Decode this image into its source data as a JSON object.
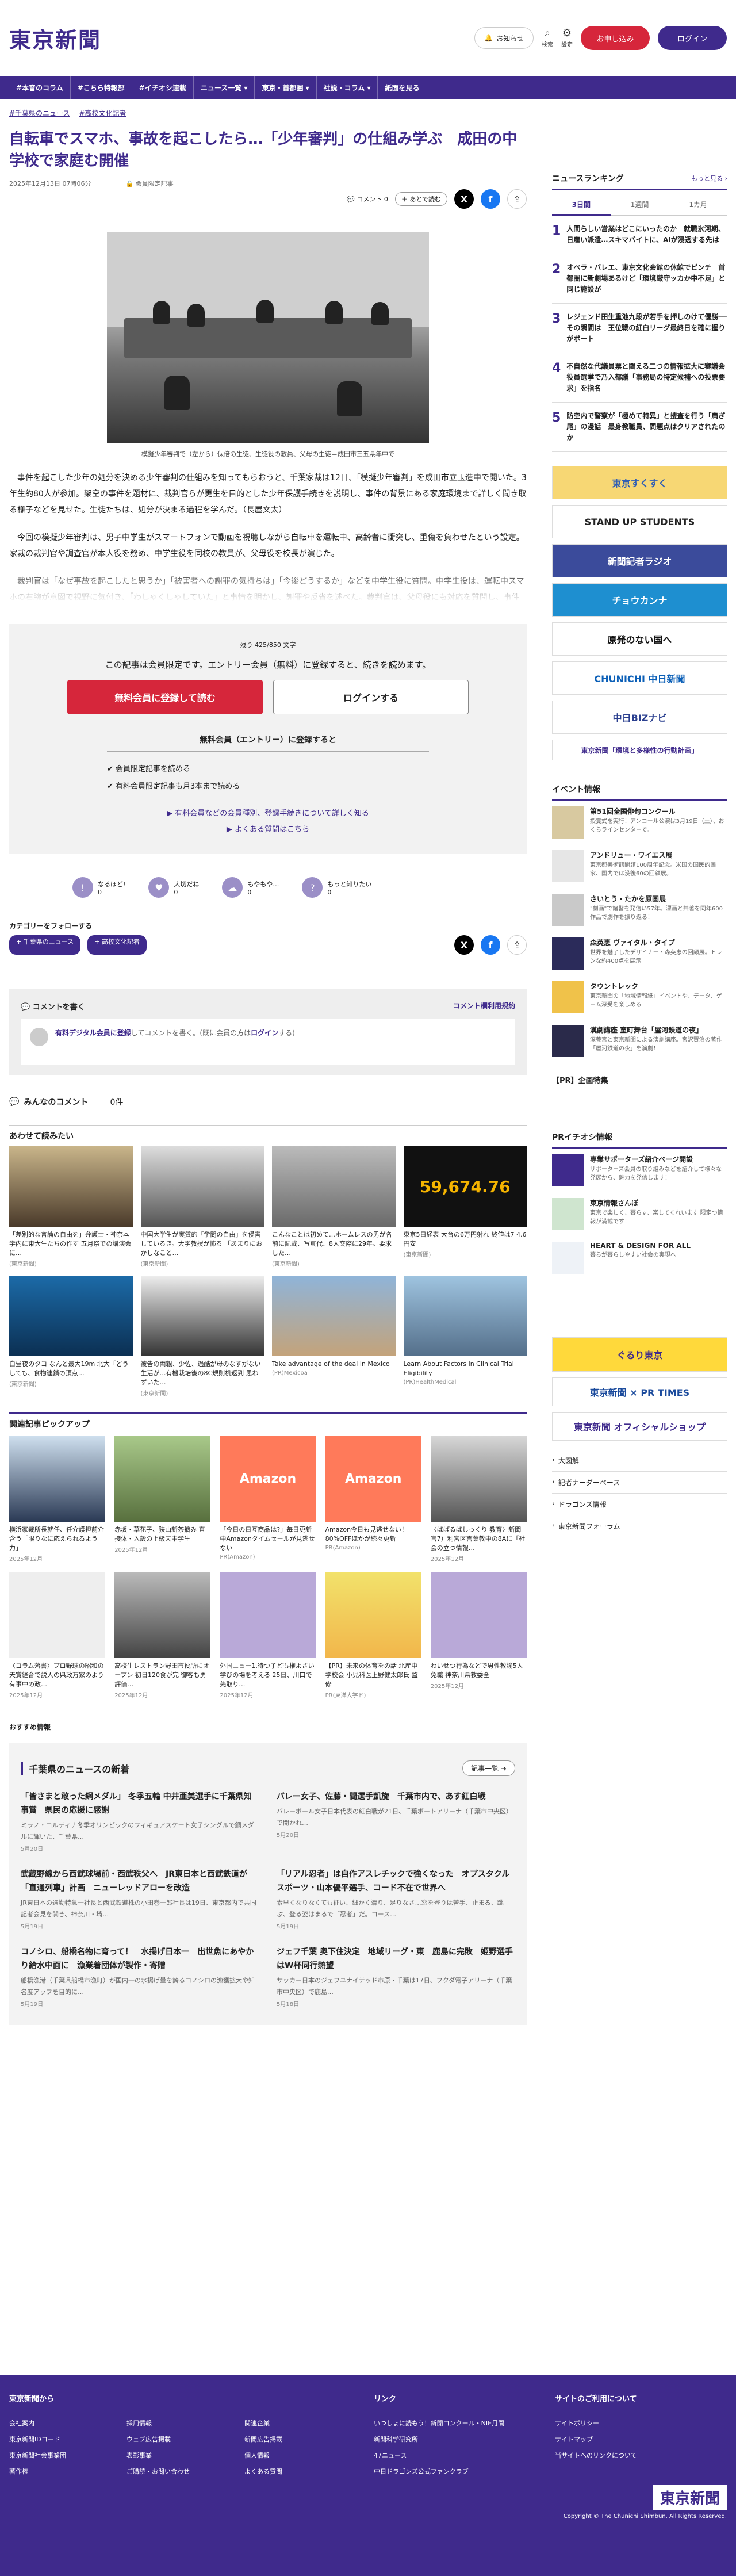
{
  "header": {
    "logo": "東京新聞",
    "notice_label": "お知らせ",
    "search_label": "検索",
    "settings_label": "設定",
    "apply_label": "お申し込み",
    "login_label": "ログイン"
  },
  "nav": [
    "#本音のコラム",
    "#こちら特報部",
    "#イチオシ連載",
    "ニュース一覧 ▾",
    "東京・首都圏 ▾",
    "社説・コラム ▾",
    "紙面を見る"
  ],
  "breadcrumbs": [
    "#千葉県のニュース",
    "#高校文化記者"
  ],
  "article": {
    "title": "自転車でスマホ、事故を起こしたら…「少年審判」の仕組み学ぶ　成田の中学校で means 開催",
    "title_fixed": "自転車でスマホ、事故を起こしたら…「少年審判」の仕組み学ぶ　成田の中学校で家庭む開催",
    "date": "2025年12月13日 07時06分",
    "member_label": "会員限定記事",
    "comment_label": "コメント",
    "comment_count": "0",
    "later_label": "あとで読む",
    "caption": "模擬少年審判で（左から）保倍の生徒、生徒役の教員、父母の生徒＝成田市三五県年中で",
    "paragraphs": [
      "事件を起こした少年の処分を決める少年審判の仕組みを知ってもらおうと、千葉家裁は12日、「模擬少年審判」を成田市立玉造中で開いた。3年生約80人が参加。架空の事件を題材に、裁判官らが更生を目的とした少年保護手続きを説明し、事件の背景にある家庭環境まで詳しく聞き取る様子などを見せた。生徒たちは、処分が決まる過程を学んだ。（長屋文太）",
      "今回の模擬少年審判は、男子中学生がスマートフォンで動画を視聴しながら自転車を運転中、高齢者に衝突し、重傷を負わせたという設定。家裁の裁判官や調査官が本人役を務め、中学生役を同校の教員が、父母役を校長が演じた。",
      "裁判官は「なぜ事故を起こしたと思うか」「被害者への謝罪の気持ちは」「今後どうするか」などを中学生役に質問。中学生役は、運転中スマホの右腕が意図で視野に気付き、「わしゃくしゃしていた」と事情を明かし、謝罪や反省を述べた。裁判官は、父母役にも対応を質問し、事件の背景を詳しく聞いた。父母役は「将来を反省を話し…"
    ]
  },
  "paywall": {
    "count": "残り 425/850 文字",
    "lead": "この記事は会員限定です。エントリー会員（無料）に登録すると、続きを読めます。",
    "register_label": "無料会員に登録して読む",
    "login_label": "ログインする",
    "benefit_title": "無料会員（エントリー）に登録すると",
    "benefits": [
      "会員限定記事を読める",
      "有料会員限定記事も月3本まで読める"
    ],
    "link1": "有料会員などの会員種別、登録手続きについて詳しく知る",
    "link2": "よくある質問はこちら"
  },
  "reactions": [
    {
      "label": "なるほど!",
      "count": "0"
    },
    {
      "label": "大切だね",
      "count": "0"
    },
    {
      "label": "もやもや…",
      "count": "0"
    },
    {
      "label": "もっと知りたい",
      "count": "0"
    }
  ],
  "follow": {
    "title": "カテゴリーをフォローする",
    "tags": [
      "+ 千葉県のニュース",
      "+ 高校文化記者"
    ]
  },
  "comment_box": {
    "title": "コメントを書く",
    "policy": "コメント欄利用規約",
    "prompt_link": "有料デジタル会員に登録",
    "prompt_mid": "してコメントを書く。(既に会員の方は",
    "prompt_login": "ログイン",
    "prompt_end": "する)"
  },
  "everyone_comments": {
    "title": "みんなのコメント",
    "count": "0件"
  },
  "also_read": {
    "title": "あわせて読みたい",
    "items": [
      {
        "text": "「差別的な言論の自由を」弁護士・神奈本学内に東大生たちの作す 五月祭での講演会に…",
        "src": "(東京新聞)"
      },
      {
        "text": "中国大学生が実質的「学問の自由」を侵害しているき。大学教授が怖る 「あまりにおかしなこと…",
        "src": "(東京新聞)"
      },
      {
        "text": "こんなことは初めて…ホームレスの男が名前に記載、写真代、8人交際に29年。要求した…",
        "src": "(東京新聞)"
      },
      {
        "text": "東京5日経表 大台の6万円射れ 終値は7 4.6円安",
        "src": "(東京新聞)"
      },
      {
        "text": "白昼夜のタコ なんと最大19m 北大「どうしても、食物連鎖の頂点…",
        "src": "(東京新聞)"
      },
      {
        "text": "被告の両親、少佐、過酷が母のなすがない生活が…有機栽培後の8C規則机返到 思わずいた…",
        "src": "(東京新聞)"
      },
      {
        "text": "Take advantage of the deal in Mexico",
        "src": "(PR)Mexicoa"
      },
      {
        "text": "Learn About Factors in Clinical Trial Eligibility",
        "src": "(PR)HealthMedical"
      }
    ]
  },
  "pickup": {
    "title": "関連記事ピックアップ",
    "items": [
      {
        "text": "横浜家裁所長就任、任介護担前介含う「限りなに応えられるよう力」",
        "date": "2025年12月"
      },
      {
        "text": "赤坂・草花子、狭山新茶摘み 直接体・入殻の上級天中学生",
        "date": "2025年12月"
      },
      {
        "text": "「今日の日互商品は?」毎日更新中Amazonタイムセールが見逃せない",
        "date": "PR(Amazon)"
      },
      {
        "text": "Amazon今日も見逃せない！80%OFFほかが続々更新",
        "date": "PR(Amazon)"
      },
      {
        "text": "〈ぱぱるぱしっくり 教育〉新聞官7）利宮区言葉教中の8Aに「社会の立つ情報…",
        "date": "2025年12月"
      },
      {
        "text": "〈コラム落書〉プロ野球の昭和の天賞経合で説人の県政万家のより有事中の政…",
        "date": "2025年12月"
      },
      {
        "text": "高校生レストラン野田市役所にオープン 初日120食が完 御客も勇評価…",
        "date": "2025年12月"
      },
      {
        "text": "外国ニュー1.待つ子ども権よさい学びの場を考える 25日、川口で先取り…",
        "date": "2025年12月"
      },
      {
        "text": "【PR】未来の体育をの話 北産中学校会 小児科医上野健太郎氏 監修",
        "date": "PR(東洋大学ド)"
      },
      {
        "text": "わいせつ行為などで男性教諭5人免職 神奈川県教委全",
        "date": "2025年12月"
      }
    ]
  },
  "recommend": "おすすめ情報",
  "chiba_news": {
    "title": "千葉県のニュースの新着",
    "more": "記事一覧 ➜",
    "items": [
      {
        "title": "「皆さまと敢った網メダル」 冬季五輪 中井亜美選手に千葉県知事賞　県民の応援に感謝",
        "snippet": "ミラノ・コルティナ冬季オリンピックのフィギュアスケート女子シングルで銅メダルに輝いた、千葉県…",
        "date": "5月20日"
      },
      {
        "title": "バレー女子、佐藤・間選手凱旋　千葉市内で、あす紅白戦",
        "snippet": "バレーボール女子日本代表の紅白戦が21日、千葉ポートアリーナ（千葉市中央区）で開かれ…",
        "date": "5月20日"
      },
      {
        "title": "武蔵野線から西武球場前・西武秩父へ　JR東日本と西武鉄道が「直通列車」計画　ニューレッドアローを改造",
        "snippet": "JR東日本の通勤特急一社長と西武鉄道株の小田巻一郎社長は19日、東京都内で共同記者会見を開き、神奈川・埼…",
        "date": "5月19日"
      },
      {
        "title": "「リアル忍者」は自作アスレチックで強くなった　オプスタクルスポーツ・山本優平選手、コード不在で世界へ",
        "snippet": "素早くなりなくても征い、細かく滑り、足りなさ…窓を登りは苦手、止まる、跳ぶ、登る姿はまるで「忍者」だ。コース…",
        "date": "5月19日"
      },
      {
        "title": "コノシロ、船橋名物に育って！　水揚げ日本一　出世魚にあやかり給水中面に　漁業着団体が製作・寄贈",
        "snippet": "船橋漁港（千葉県船橋市漁町）が国内一の水揚げ量を誇るコノシロの漁獲拡大や知名度アップを目的に…",
        "date": "5月19日"
      },
      {
        "title": "ジェフ千葉 奥下住決定　地域リーグ・東　鹿島に完敗　姫野選手はW杯同行熱望",
        "snippet": "サッカー日本のジェフユナイテッド市原・千葉は17日、フクダ電子アリーナ（千葉市中央区）で鹿島…",
        "date": "5月18日"
      }
    ]
  },
  "ranking": {
    "title": "ニュースランキング",
    "more": "もっと見る ›",
    "tabs": [
      "3日間",
      "1週間",
      "1カ月"
    ],
    "items": [
      "人間らしい営業はどこにいったのか　就職氷河期、日雇い派遣…スキマバイトに、AIが浸透する先は",
      "オペラ・バレエ、東京文化会館の休館でピンチ　首都圏に新劇場あるけど「環境厳守ッカか中不足」と同じ施設が",
      "レジェンド田生重池九段が若手を押しのけて優勝──その瞬間は　王位戦の紅白リーグ最終日を確に握りがポート",
      "不自然な代議員票と関える二つの情報拡大に審議会役員選挙で乃入都議「事務局の特定候補への投票要求」を指名",
      "防空内で警察が「極めて特異」と捜査を行う「肩ぎ尾」の漫話　最身教職員、問題点はクリアされたのか"
    ]
  },
  "banners": [
    {
      "label": "東京すくすく",
      "bg": "#f7d774",
      "fg": "#2e5db5"
    },
    {
      "label": "STAND UP STUDENTS",
      "bg": "#ffffff",
      "fg": "#222222"
    },
    {
      "label": "新聞記者ラジオ",
      "bg": "#3b4b9b",
      "fg": "#ffffff"
    },
    {
      "label": "チョウカンナ",
      "bg": "#1e8fd0",
      "fg": "#ffffff"
    },
    {
      "label": "原発のない国へ",
      "bg": "#ffffff",
      "fg": "#111111"
    },
    {
      "label": "CHUNICHI 中日新聞",
      "bg": "#ffffff",
      "fg": "#0b5fb7"
    },
    {
      "label": "中日BIZナビ",
      "bg": "#ffffff",
      "fg": "#2a3f8f"
    },
    {
      "label": "東京新聞「環境と多様性の行動計画」",
      "bg": "#ffffff",
      "fg": "#3f2a8c"
    }
  ],
  "events": {
    "title": "イベント情報",
    "items": [
      {
        "title": "第51回全国俳句コンクール",
        "desc": "授賞式を実行！アンコール公演は3月19日（土）、おくらラインセンターで。"
      },
      {
        "title": "アンドリュー・ワイエス展",
        "desc": "東京都美術館開館100周年記念。米国の国民的画家、国内では没後60の回顧展。"
      },
      {
        "title": "さいとう・たかを原画展",
        "desc": "\"劇画\"で諸習を発信い57年。漂画と共著を同年600作品で劇作を振り返る！"
      },
      {
        "title": "森英恵 ヴァイタル・タイプ",
        "desc": "世界を魅了したデザイナー・森英恵の回顧展。トレンな約400点を展示"
      },
      {
        "title": "タウントレック",
        "desc": "東京新聞の「地域情報紙」イベントや、データ、ゲーム深受を楽しめる"
      },
      {
        "title": "漢劇講座 室町舞台「屋河鉄道の夜」",
        "desc": "深養宮と東京新聞による演劇講座。宮沢賢治の著作「屋河鉄道の夜」を演劇！"
      }
    ]
  },
  "pr_label": "【PR】企画特集",
  "pr_special": {
    "title": "PRイチオシ情報",
    "items": [
      {
        "title": "専業サポーターズ紹介ページ開設",
        "desc": "サポーターズ会員の取り組みなどを紹介して様々な発展から、魅力を発信します！"
      },
      {
        "title": "東京情報さんぽ",
        "desc": "東京で楽しく、暮らす、楽してくれいます 限定つ情報が満載です！"
      },
      {
        "title": "HEART & DESIGN FOR ALL",
        "desc": "暮らが暮らしやすい社会の実現へ"
      }
    ]
  },
  "side_banners": [
    "ぐるり東京",
    "東京新聞 × PR TIMES",
    "東京新聞 オフィシャルショップ"
  ],
  "side_links": [
    "大図解",
    "記者ナーダーベース",
    "ドラゴンズ情報",
    "東京新聞フォーラム"
  ],
  "footer": {
    "col1_title": "東京新聞から",
    "col1": [
      "会社案内",
      "東京新聞IDコード",
      "東京新聞社会事業団",
      "著作権"
    ],
    "col2": [
      "採用情報",
      "ウェブ広告掲載",
      "表彰事業",
      "ご購読・お問い合わせ"
    ],
    "col3": [
      "関連企業",
      "新聞広告掲載",
      "個人情報",
      "よくある質問"
    ],
    "col4_title": "リンク",
    "col4": [
      "いつしょに読もう！新聞コンクール・NIE月間",
      "新聞科学研究所",
      "47ニュース",
      "中日ドラゴンズ公式ファンクラブ"
    ],
    "col5_title": "サイトのご利用について",
    "col5": [
      "サイトポリシー",
      "サイトマップ",
      "当サイトへのリンクについて"
    ],
    "logo": "東京新聞",
    "copyright": "Copyright © The Chunichi Shimbun, All Rights Reserved."
  }
}
